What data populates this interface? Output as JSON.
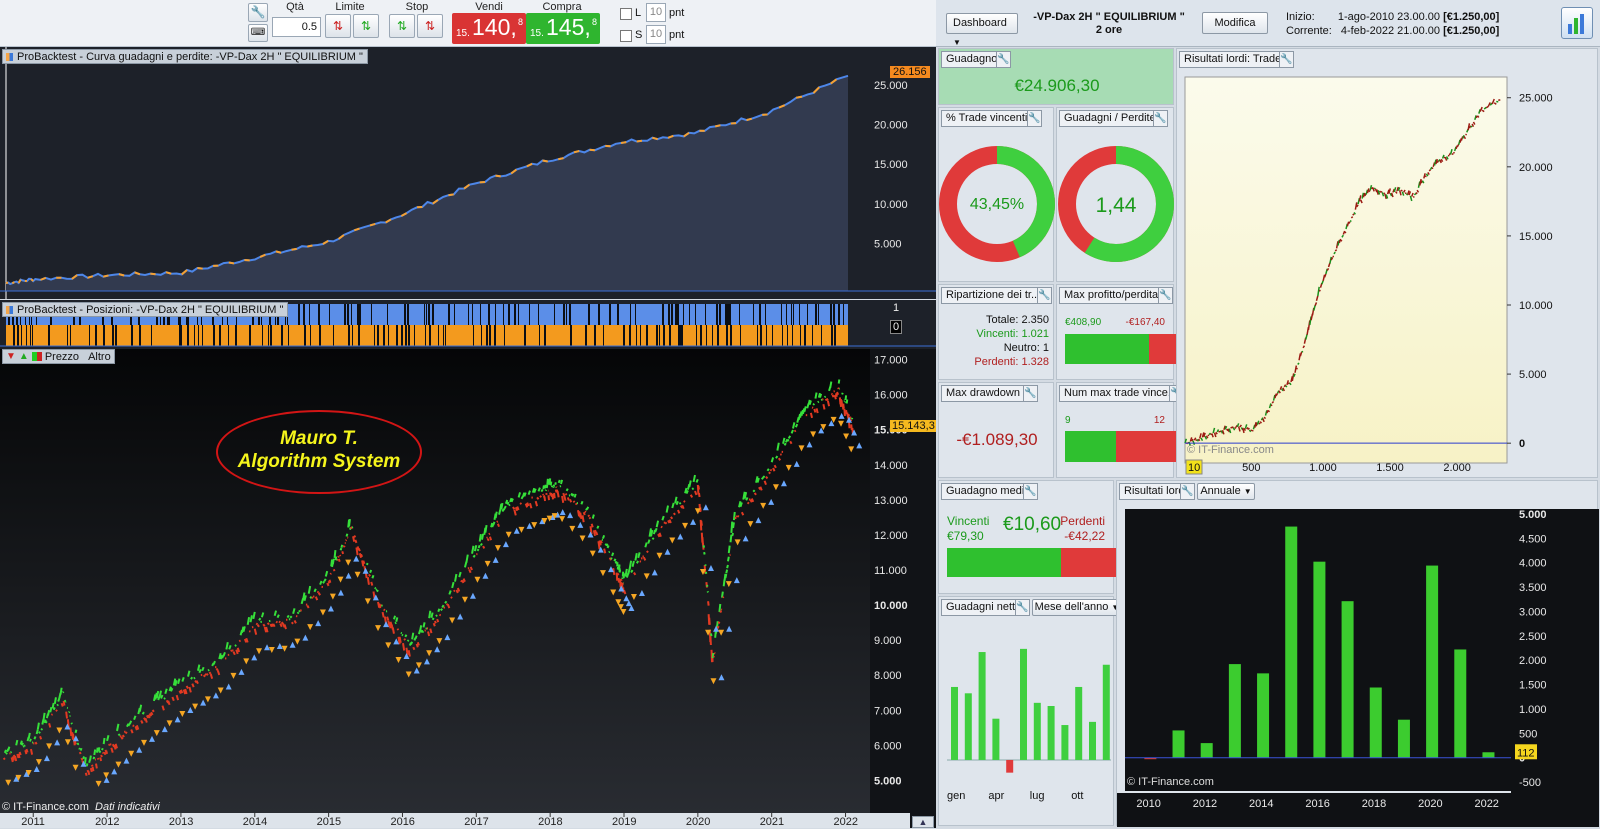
{
  "toolbar": {
    "qty_label": "Qtà",
    "qty_value": "0.5",
    "limit_label": "Limite",
    "stop_label": "Stop",
    "sell_label": "Vendi",
    "buy_label": "Compra",
    "sell_price_prefix": "15.",
    "sell_price_main": "140,",
    "sell_price_sup": "8",
    "buy_price_prefix": "15.",
    "buy_price_main": "145,",
    "buy_price_sup": "8",
    "l_label": "L",
    "s_label": "S",
    "l_points": "10",
    "s_points": "10",
    "pnt_label": "pnt",
    "colors": {
      "sell": "#d93434",
      "buy": "#2fb52f"
    }
  },
  "equity_chart": {
    "title": "ProBacktest - Curva guadagni e perdite: -VP-Dax 2H  \" EQUILIBRIUM \"",
    "last_value_label": "26.156",
    "y_ticks": [
      "25.000",
      "20.000",
      "15.000",
      "10.000",
      "5.000"
    ],
    "chart_data": {
      "type": "area",
      "x": [
        2010.6,
        2011,
        2012,
        2013,
        2014,
        2015,
        2016,
        2017,
        2018,
        2019,
        2020,
        2021,
        2022.1
      ],
      "values": [
        0,
        500,
        1000,
        1300,
        3200,
        5200,
        8600,
        12500,
        15500,
        17800,
        18900,
        21500,
        26156
      ],
      "ylim": [
        -1000,
        27500
      ]
    }
  },
  "positions_chart": {
    "title": "ProBacktest - Posizioni: -VP-Dax 2H  \" EQUILIBRIUM \"",
    "y_top": "1",
    "y_bottom": "0"
  },
  "price_chart": {
    "btn_price": "Prezzo",
    "btn_other": "Altro",
    "last_price_label": "15.143,3",
    "annotation_line1": "Mauro T.",
    "annotation_line2": "Algorithm System",
    "footer_brand": "© IT-Finance.com",
    "footer_note": "Dati indicativi",
    "y_ticks": [
      "17.000",
      "16.000",
      "15.000",
      "14.000",
      "13.000",
      "12.000",
      "11.000",
      "10.000",
      "9.000",
      "8.000",
      "7.000",
      "6.000",
      "5.000"
    ],
    "x_ticks": [
      "2011",
      "2012",
      "2013",
      "2014",
      "2015",
      "2016",
      "2017",
      "2018",
      "2019",
      "2020",
      "2021",
      "2022"
    ],
    "chart_data": {
      "type": "line",
      "x": [
        2010.6,
        2011.0,
        2011.4,
        2011.7,
        2012.0,
        2012.5,
        2013.0,
        2013.5,
        2014.0,
        2014.5,
        2015.0,
        2015.3,
        2015.7,
        2016.1,
        2016.5,
        2017.0,
        2017.4,
        2017.9,
        2018.1,
        2018.5,
        2018.9,
        2019.0,
        2019.5,
        2020.0,
        2020.2,
        2020.5,
        2021.0,
        2021.5,
        2021.9,
        2022.1
      ],
      "values": [
        5700,
        6100,
        7400,
        5300,
        6000,
        6900,
        7700,
        8300,
        9500,
        9600,
        10800,
        12200,
        10000,
        8800,
        9800,
        11500,
        12800,
        13200,
        13400,
        12600,
        11000,
        10600,
        12300,
        13500,
        8500,
        12500,
        14000,
        15600,
        16200,
        15143
      ],
      "ylim": [
        4700,
        17300
      ]
    }
  },
  "dashboard": {
    "menu_label": "Dashboard",
    "system_name": "-VP-Dax 2H  \" EQUILIBRIUM \"",
    "timeframe": "2 ore",
    "edit_button": "Modifica",
    "start_label": "Inizio:",
    "start_value": "1-ago-2010 23.00.00",
    "start_capital": "[€1.250,00]",
    "current_label": "Corrente:",
    "current_value": "4-feb-2022 21.00.00",
    "current_capital": "[€1.250,00]",
    "profit": {
      "title": "Guadagno",
      "value": "€24.906,30"
    },
    "winning_pct": {
      "title": "% Trade vincenti",
      "value": "43,45%",
      "fraction": 0.4345
    },
    "profit_loss": {
      "title": "Guadagni / Perdite",
      "value": "1,44",
      "fraction": 0.59
    },
    "distribution": {
      "title": "Ripartizione dei tr...",
      "total_label": "Totale:",
      "total": "2.350",
      "win_label": "Vincenti:",
      "win": "1.021",
      "neutral_label": "Neutro:",
      "neutral": "1",
      "loss_label": "Perdenti:",
      "loss": "1.328"
    },
    "max_pl": {
      "title": "Max profitto/perdita",
      "profit": "€408,90",
      "loss": "-€167,40",
      "fraction": 0.71
    },
    "max_drawdown": {
      "title": "Max drawdown",
      "value": "-€1.089,30"
    },
    "max_consec": {
      "title": "Num max trade vince...",
      "win": "9",
      "loss": "12",
      "fraction": 0.43
    },
    "avg_gain": {
      "title": "Guadagno medio",
      "win_label": "Vincenti",
      "win": "€79,30",
      "value": "€10,60",
      "loss_label": "Perdenti",
      "loss": "-€42,22",
      "fraction": 0.65
    },
    "net_gains": {
      "title": "Guadagni netti",
      "dropdown": "Mese dell'anno",
      "x_labels": [
        "gen",
        "apr",
        "lug",
        "ott"
      ],
      "chart_data": {
        "type": "bar",
        "categories": [
          "gen",
          "feb",
          "mar",
          "apr",
          "mag",
          "giu",
          "lug",
          "ago",
          "set",
          "ott",
          "nov",
          "dic"
        ],
        "values": [
          2.3,
          2.1,
          3.4,
          1.3,
          -0.4,
          3.5,
          1.8,
          1.7,
          1.1,
          2.3,
          1.2,
          3.0
        ],
        "ylim": [
          -0.6,
          4.0
        ]
      }
    },
    "gross_trades": {
      "title": "Risultati lordi: Trade",
      "brand": "© IT-Finance.com",
      "x_ticks": [
        "500",
        "1.000",
        "1.500",
        "2.000"
      ],
      "x_badge": "10",
      "y_ticks": [
        "25.000",
        "20.000",
        "15.000",
        "10.000",
        "5.000",
        "0"
      ],
      "chart_data": {
        "type": "line",
        "x": [
          0,
          100,
          200,
          300,
          400,
          500,
          600,
          700,
          800,
          900,
          1000,
          1100,
          1200,
          1300,
          1400,
          1500,
          1600,
          1700,
          1800,
          1900,
          2000,
          2100,
          2200,
          2350
        ],
        "values": [
          0,
          300,
          700,
          1000,
          1200,
          900,
          2000,
          3800,
          4500,
          7500,
          11000,
          13500,
          15500,
          17500,
          18500,
          18000,
          18300,
          17800,
          19500,
          20500,
          21000,
          22500,
          24000,
          24906
        ],
        "xlim": [
          0,
          2400
        ],
        "ylim": [
          -1000,
          26500
        ]
      }
    },
    "gross_annual": {
      "title": "Risultati lordi",
      "dropdown": "Annuale",
      "brand": "© IT-Finance.com",
      "last_badge": "112",
      "y_ticks": [
        "5.000",
        "4.500",
        "4.000",
        "3.500",
        "3.000",
        "2.500",
        "2.000",
        "1.500",
        "1.000",
        "500",
        "0",
        "-500"
      ],
      "x_ticks": [
        "2010",
        "2012",
        "2014",
        "2016",
        "2018",
        "2020",
        "2022"
      ],
      "chart_data": {
        "type": "bar",
        "categories": [
          "2010",
          "2011",
          "2012",
          "2013",
          "2014",
          "2015",
          "2016",
          "2017",
          "2018",
          "2019",
          "2020",
          "2021",
          "2022"
        ],
        "values": [
          -30,
          560,
          300,
          1920,
          1730,
          4740,
          4020,
          3210,
          1440,
          780,
          3940,
          2220,
          112
        ],
        "ylim": [
          -600,
          5100
        ]
      }
    }
  }
}
